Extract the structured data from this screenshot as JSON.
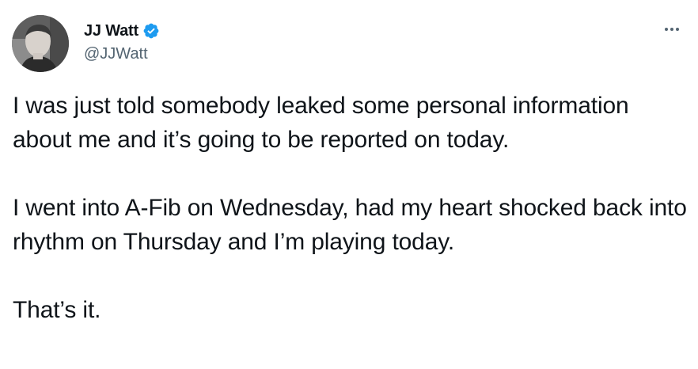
{
  "author": {
    "display_name": "JJ Watt",
    "handle": "@JJWatt",
    "verified": true,
    "verified_icon": "verified-badge-icon",
    "avatar": "user-avatar-photo"
  },
  "menu": {
    "icon": "more-options-icon"
  },
  "tweet": {
    "paragraphs": [
      "I was just told somebody leaked some personal information about me and it’s going to be reported on today.",
      "I went into A-Fib on Wednesday, had my heart shocked back into rhythm on Thursday and I’m playing today.",
      "That’s it."
    ]
  },
  "colors": {
    "text_primary": "#0f1419",
    "text_secondary": "#536471",
    "verified_blue": "#1d9bf0",
    "background": "#ffffff"
  }
}
